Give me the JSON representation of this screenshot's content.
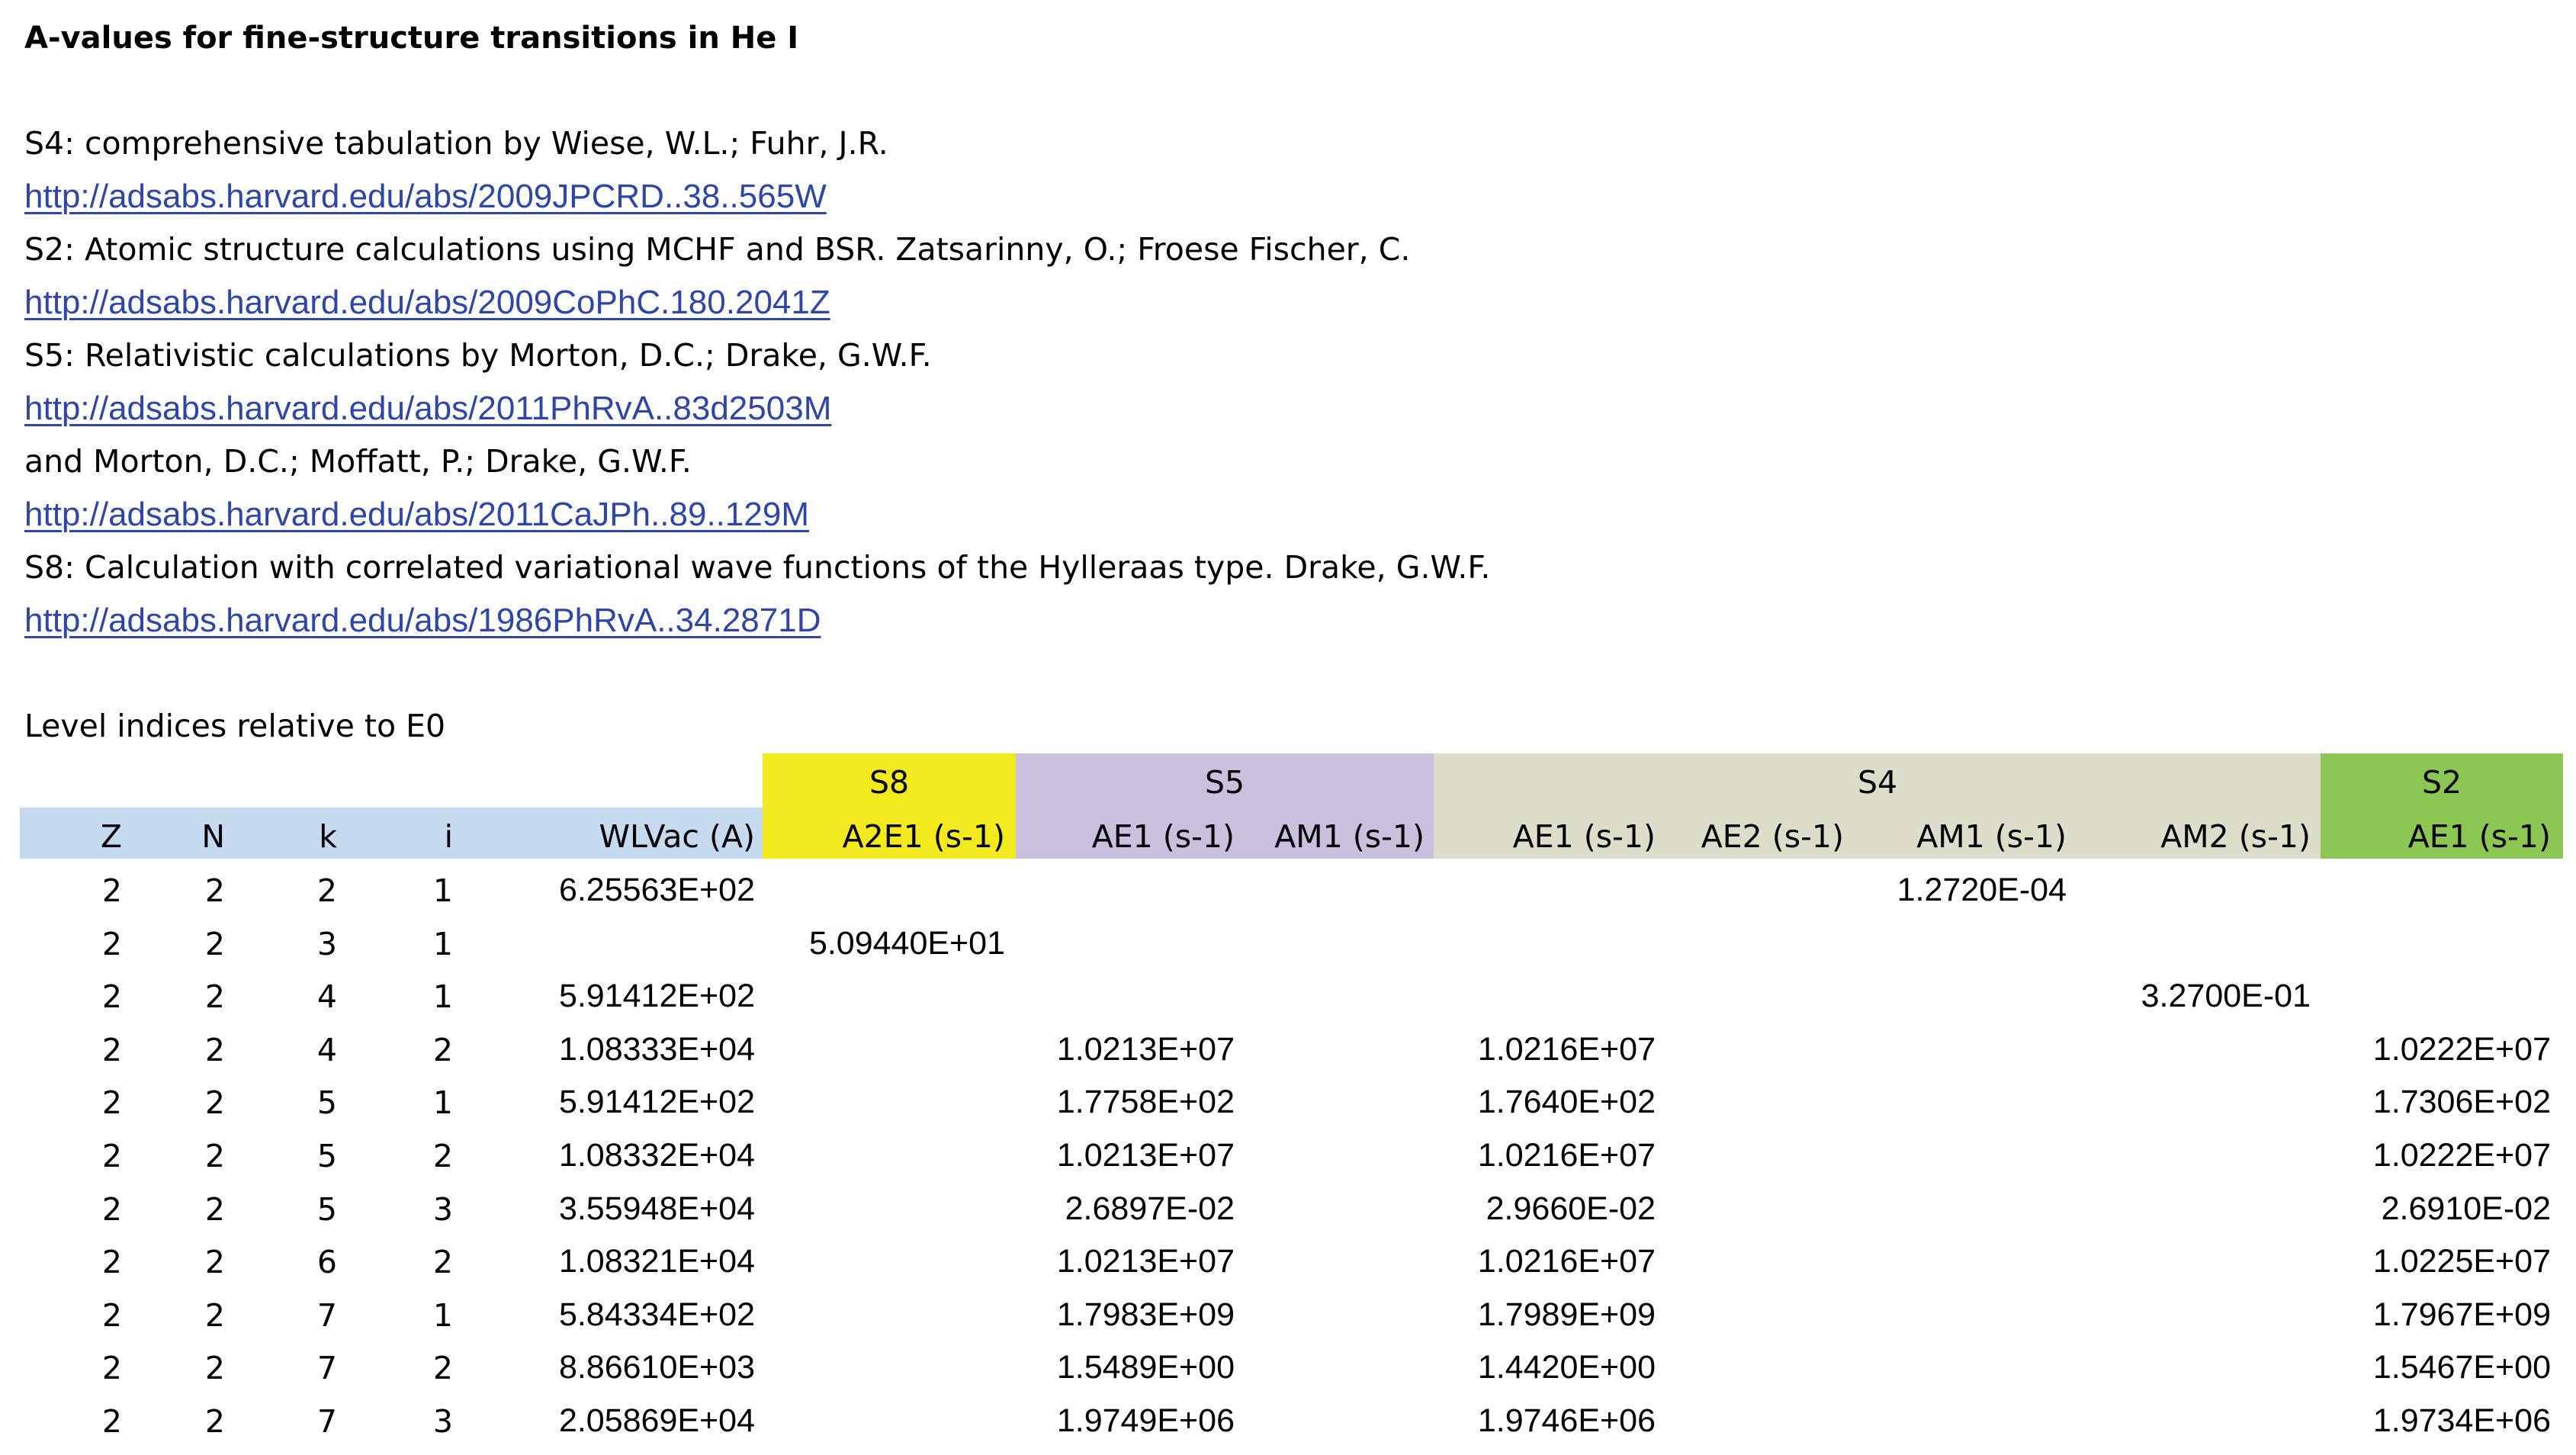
{
  "title": "A-values for  fine-structure transitions in He I",
  "references": [
    {
      "text": "S4: comprehensive tabulation by Wiese, W.L.; Fuhr, J.R.",
      "link": "http://adsabs.harvard.edu/abs/2009JPCRD..38..565W"
    },
    {
      "text": "S2: Atomic structure calculations using MCHF and BSR. Zatsarinny, O.; Froese Fischer, C.",
      "link": "http://adsabs.harvard.edu/abs/2009CoPhC.180.2041Z"
    },
    {
      "text": "S5: Relativistic calculations by Morton, D.C.; Drake, G.W.F.",
      "link": "http://adsabs.harvard.edu/abs/2011PhRvA..83d2503M"
    },
    {
      "text": "and Morton, D.C.; Moffatt, P.; Drake, G.W.F.",
      "link": "http://adsabs.harvard.edu/abs/2011CaJPh..89..129M"
    },
    {
      "text": "S8: Calculation with correlated variational wave functions of the Hylleraas type. Drake, G.W.F.",
      "link": "http://adsabs.harvard.edu/abs/1986PhRvA..34.2871D"
    }
  ],
  "level_note": "Level indices relative to E0",
  "colors": {
    "link": "#2e46a5",
    "s8": "#f2e91f",
    "s5": "#cabfdc",
    "s4": "#ddddc9",
    "s2": "#8cc753",
    "header_row": "#c5d9ef"
  },
  "source_headers": [
    "S8",
    "S5",
    "S4",
    "S2"
  ],
  "columns": [
    "Z",
    "N",
    "k",
    "i",
    "WLVac (A)",
    "A2E1 (s-1)",
    "AE1 (s-1)",
    "AM1 (s-1)",
    "AE1 (s-1)",
    "AE2 (s-1)",
    "AM1 (s-1)",
    "AM2 (s-1)",
    "AE1 (s-1)"
  ],
  "rows": [
    [
      "2",
      "2",
      "2",
      "1",
      "6.25563E+02",
      "",
      "",
      "",
      "",
      "",
      "1.2720E-04",
      "",
      ""
    ],
    [
      "2",
      "2",
      "3",
      "1",
      "",
      "5.09440E+01",
      "",
      "",
      "",
      "",
      "",
      "",
      ""
    ],
    [
      "2",
      "2",
      "4",
      "1",
      "5.91412E+02",
      "",
      "",
      "",
      "",
      "",
      "",
      "3.2700E-01",
      ""
    ],
    [
      "2",
      "2",
      "4",
      "2",
      "1.08333E+04",
      "",
      "1.0213E+07",
      "",
      "1.0216E+07",
      "",
      "",
      "",
      "1.0222E+07"
    ],
    [
      "2",
      "2",
      "5",
      "1",
      "5.91412E+02",
      "",
      "1.7758E+02",
      "",
      "1.7640E+02",
      "",
      "",
      "",
      "1.7306E+02"
    ],
    [
      "2",
      "2",
      "5",
      "2",
      "1.08332E+04",
      "",
      "1.0213E+07",
      "",
      "1.0216E+07",
      "",
      "",
      "",
      "1.0222E+07"
    ],
    [
      "2",
      "2",
      "5",
      "3",
      "3.55948E+04",
      "",
      "2.6897E-02",
      "",
      "2.9660E-02",
      "",
      "",
      "",
      "2.6910E-02"
    ],
    [
      "2",
      "2",
      "6",
      "2",
      "1.08321E+04",
      "",
      "1.0213E+07",
      "",
      "1.0216E+07",
      "",
      "",
      "",
      "1.0225E+07"
    ],
    [
      "2",
      "2",
      "7",
      "1",
      "5.84334E+02",
      "",
      "1.7983E+09",
      "",
      "1.7989E+09",
      "",
      "",
      "",
      "1.7967E+09"
    ],
    [
      "2",
      "2",
      "7",
      "2",
      "8.86610E+03",
      "",
      "1.5489E+00",
      "",
      "1.4420E+00",
      "",
      "",
      "",
      "1.5467E+00"
    ],
    [
      "2",
      "2",
      "7",
      "3",
      "2.05869E+04",
      "",
      "1.9749E+06",
      "",
      "1.9746E+06",
      "",
      "",
      "",
      "1.9734E+06"
    ]
  ]
}
